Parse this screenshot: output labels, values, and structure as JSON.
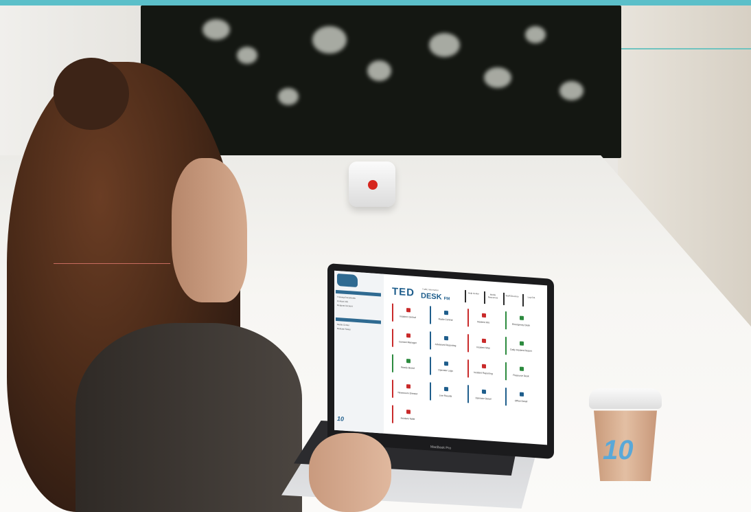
{
  "laptop": {
    "brand_label": "MacBook Pro",
    "app": {
      "logo_main": "TED",
      "logo_desk": "DESK",
      "logo_suffix": "FM",
      "logo_sub": "Traffic Information",
      "header_buttons": [
        "Help Center",
        "Media Resources",
        "Staff Directory",
        "Log Out"
      ],
      "sidebar": {
        "headings": [
          "Quick Links",
          "Resources"
        ],
        "items": [
          "Training Documents",
          "Contact Info",
          "Request Account",
          "Media Center",
          "Release Notes"
        ]
      },
      "tiles": [
        {
          "label": "Incident Central",
          "color": "#c92a2a"
        },
        {
          "label": "Radio Central",
          "color": "#1f5e8c"
        },
        {
          "label": "Incident Info",
          "color": "#c92a2a"
        },
        {
          "label": "Emergency Desk",
          "color": "#2c8a3e"
        },
        {
          "label": "Contact Manager",
          "color": "#c92a2a"
        },
        {
          "label": "Advanced Reporting",
          "color": "#1f5e8c"
        },
        {
          "label": "Incident Map",
          "color": "#c92a2a"
        },
        {
          "label": "Daily Incident Report",
          "color": "#2c8a3e"
        },
        {
          "label": "Ready Board",
          "color": "#2c8a3e"
        },
        {
          "label": "Operator Logs",
          "color": "#1f5e8c"
        },
        {
          "label": "Incident Reporting",
          "color": "#c92a2a"
        },
        {
          "label": "Resource Desk",
          "color": "#2c8a3e"
        },
        {
          "label": "Newsroom Director",
          "color": "#c92a2a"
        },
        {
          "label": "Live Results",
          "color": "#1f5e8c"
        },
        {
          "label": "Operator Detail",
          "color": "#1f5e8c"
        },
        {
          "label": "Office Detail",
          "color": "#1f5e8c"
        },
        {
          "label": "Incident Table",
          "color": "#c92a2a"
        }
      ],
      "footer_logo": "10"
    }
  },
  "cup": {
    "logo": "10"
  }
}
